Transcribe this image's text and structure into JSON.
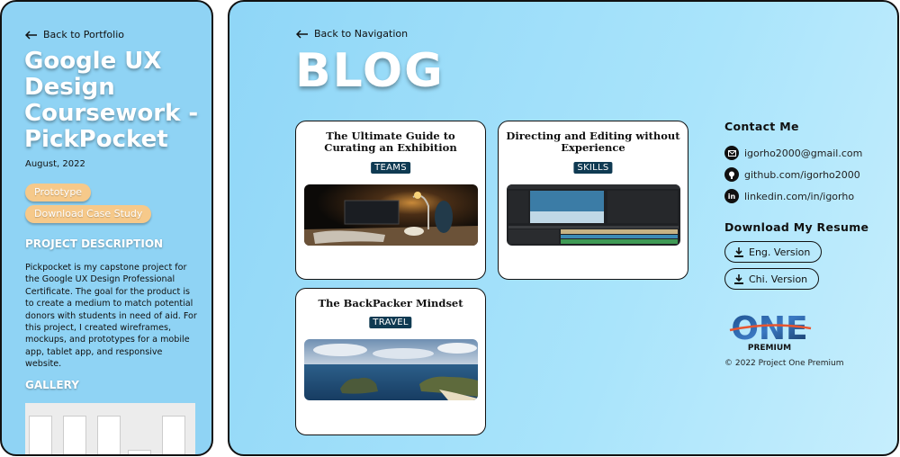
{
  "left": {
    "back_label": "Back to Portfolio",
    "title": "Google UX Design Coursework - PickPocket",
    "date": "August, 2022",
    "prototype_label": "Prototype",
    "download_label": "Download Case Study",
    "desc_heading": "PROJECT DESCRIPTION",
    "description": "Pickpocket is my capstone project for the Google UX Design Professional Certificate. The goal for the product is to create a medium to match potential donors with students in need of aid. For this project, I created wireframes, mockups, and prototypes for a mobile app, tablet app, and responsive website.",
    "gallery_heading": "GALLERY"
  },
  "main": {
    "back_label": "Back to Navigation",
    "title": "BLOG",
    "cards": [
      {
        "title": "The Ultimate Guide to Curating an Exhibition",
        "tag": "TEAMS"
      },
      {
        "title": "Directing and Editing without Experience",
        "tag": "SKILLS"
      },
      {
        "title": "The BackPacker Mindset",
        "tag": "TRAVEL"
      }
    ]
  },
  "contact": {
    "heading": "Contact Me",
    "items": [
      {
        "icon": "mail-icon",
        "text": "igorho2000@gmail.com"
      },
      {
        "icon": "github-icon",
        "text": "github.com/igorho2000"
      },
      {
        "icon": "linkedin-icon",
        "text": "linkedin.com/in/igorho"
      }
    ]
  },
  "resume": {
    "heading": "Download My Resume",
    "eng": "Eng. Version",
    "chi": "Chi. Version"
  },
  "logo": {
    "word": "ONE",
    "sub": "PREMIUM"
  },
  "copyright": "© 2022 Project One Premium"
}
